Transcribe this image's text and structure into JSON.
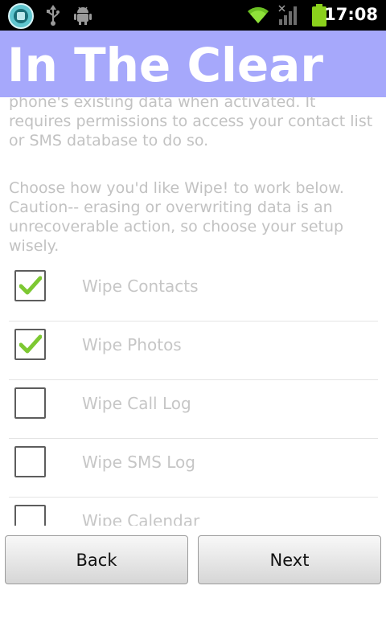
{
  "status_bar": {
    "time": "17:08",
    "left_icons": [
      "app-icon",
      "usb-icon",
      "android-debug-icon"
    ],
    "right_icons": [
      "wifi-icon",
      "signal-icon",
      "battery-icon"
    ]
  },
  "header": {
    "title": "In The Clear"
  },
  "content": {
    "paragraph_1": "phone's existing data when activated. It requires permissions to access your contact list or SMS database to do so.",
    "paragraph_2": "Choose how you'd like Wipe! to work below. Caution-- erasing or overwriting data is an unrecoverable action, so choose your setup wisely.",
    "options": [
      {
        "label": "Wipe Contacts",
        "checked": true
      },
      {
        "label": "Wipe Photos",
        "checked": true
      },
      {
        "label": "Wipe Call Log",
        "checked": false
      },
      {
        "label": "Wipe SMS Log",
        "checked": false
      },
      {
        "label": "Wipe Calendar",
        "checked": false
      }
    ]
  },
  "buttons": {
    "back": "Back",
    "next": "Next"
  },
  "colors": {
    "title_bar": "#a6a8fb",
    "check_green": "#7dc832",
    "battery_green": "#8bd11c"
  }
}
